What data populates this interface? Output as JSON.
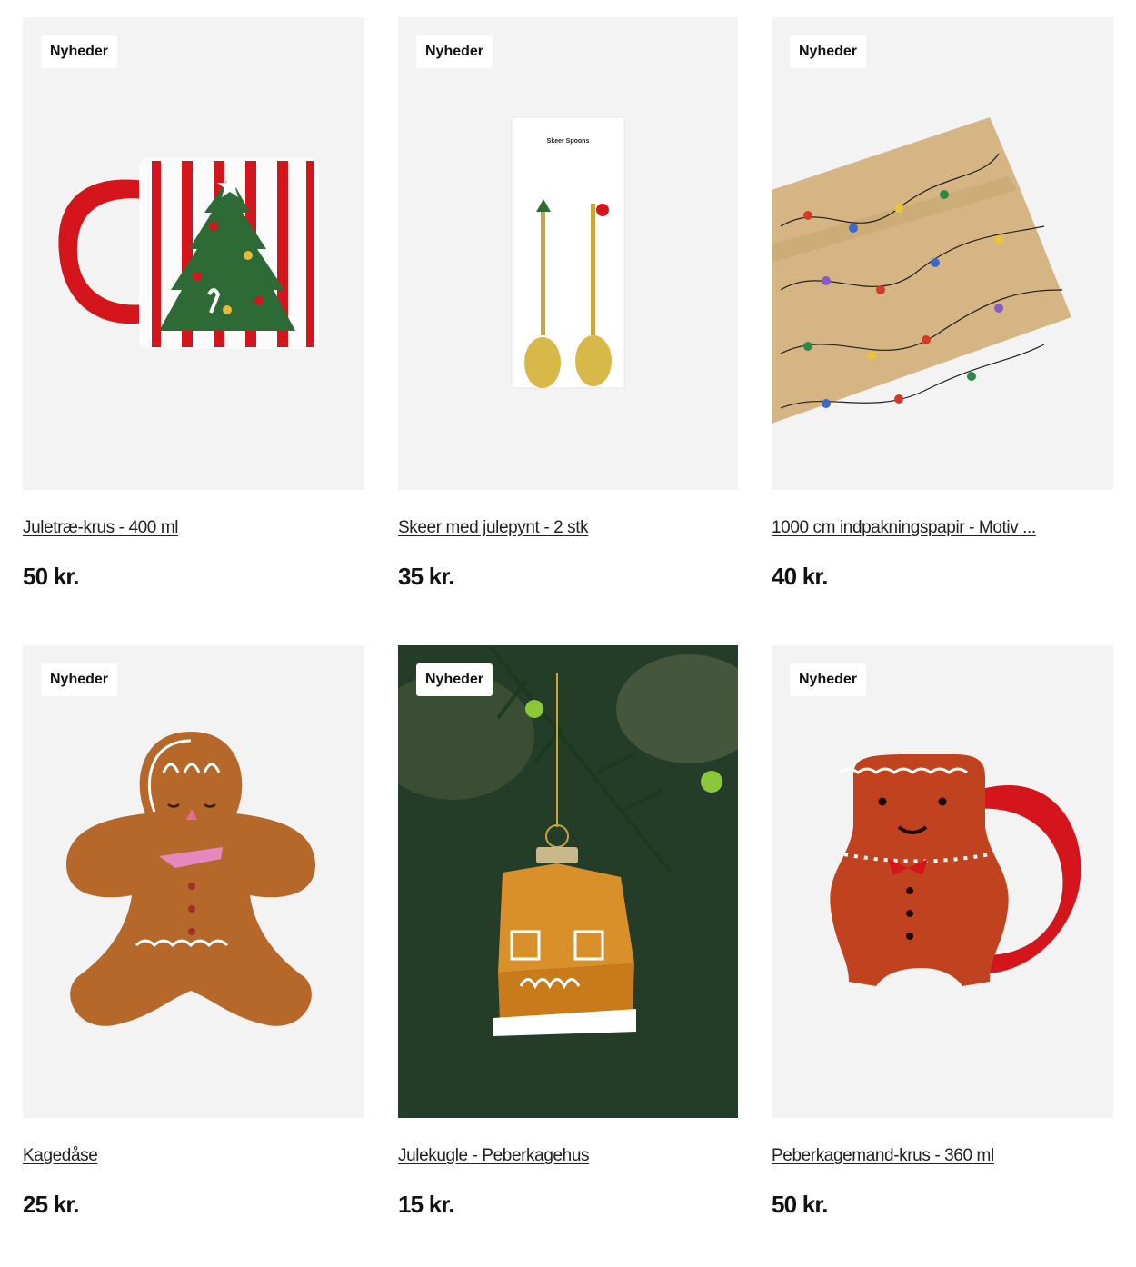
{
  "products": [
    {
      "badge": "Nyheder",
      "name": "Juletræ-krus - 400 ml",
      "price": "50 kr."
    },
    {
      "badge": "Nyheder",
      "name": "Skeer med julepynt - 2 stk",
      "price": "35 kr.",
      "package_text": "Skeer Spoons"
    },
    {
      "badge": "Nyheder",
      "name": "1000 cm indpakningspapir - Motiv ...",
      "price": "40 kr."
    },
    {
      "badge": "Nyheder",
      "name": "Kagedåse",
      "price": "25 kr."
    },
    {
      "badge": "Nyheder",
      "name": "Julekugle - Peberkagehus",
      "price": "15 kr."
    },
    {
      "badge": "Nyheder",
      "name": "Peberkagemand-krus - 360 ml",
      "price": "50 kr."
    }
  ],
  "colors": {
    "image_bg": "#f3f3f3",
    "badge_bg": "#ffffff",
    "text": "#111111",
    "mug_red": "#d4161c",
    "tree_green": "#2d6a36",
    "gingerbread": "#b5682a"
  }
}
